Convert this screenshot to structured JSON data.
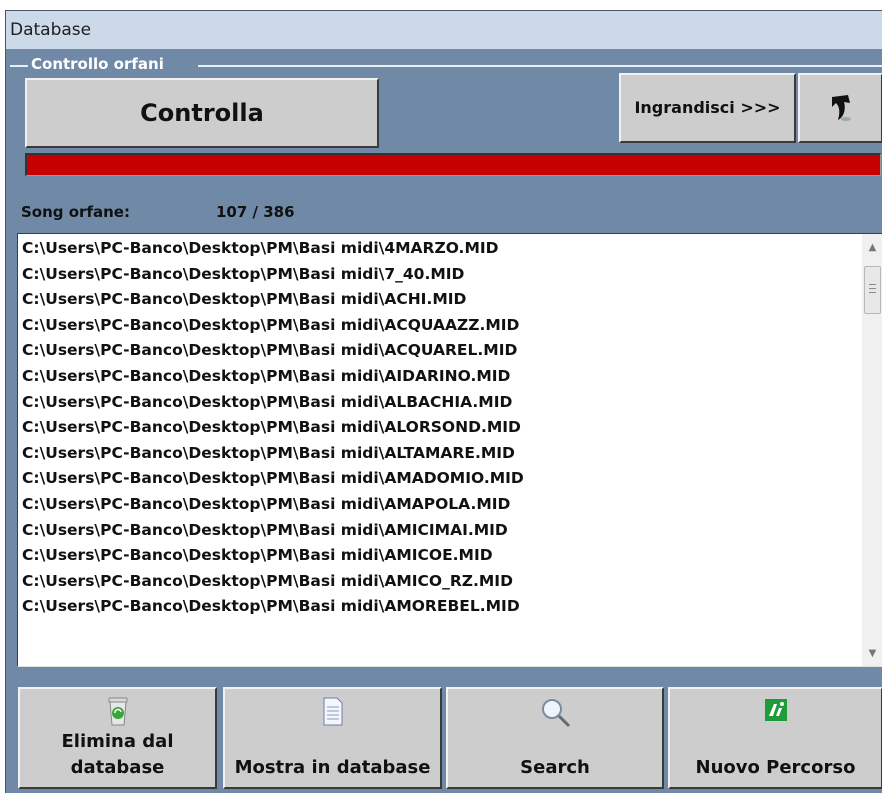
{
  "window": {
    "title": "Database"
  },
  "group": {
    "label": "Controllo orfani"
  },
  "buttons": {
    "controlla": "Controlla",
    "ingrandisci": "Ingrandisci >>>",
    "back_icon": "undo-arrow-icon"
  },
  "progress": {
    "fraction": 1.0,
    "color": "#c60000"
  },
  "orphans": {
    "label": "Song orfane:",
    "value": "107 / 386"
  },
  "list": {
    "items": [
      "C:\\Users\\PC-Banco\\Desktop\\PM\\Basi midi\\4MARZO.MID",
      "C:\\Users\\PC-Banco\\Desktop\\PM\\Basi midi\\7_40.MID",
      "C:\\Users\\PC-Banco\\Desktop\\PM\\Basi midi\\ACHI.MID",
      "C:\\Users\\PC-Banco\\Desktop\\PM\\Basi midi\\ACQUAAZZ.MID",
      "C:\\Users\\PC-Banco\\Desktop\\PM\\Basi midi\\ACQUAREL.MID",
      "C:\\Users\\PC-Banco\\Desktop\\PM\\Basi midi\\AIDARINO.MID",
      "C:\\Users\\PC-Banco\\Desktop\\PM\\Basi midi\\ALBACHIA.MID",
      "C:\\Users\\PC-Banco\\Desktop\\PM\\Basi midi\\ALORSOND.MID",
      "C:\\Users\\PC-Banco\\Desktop\\PM\\Basi midi\\ALTAMARE.MID",
      "C:\\Users\\PC-Banco\\Desktop\\PM\\Basi midi\\AMADOMIO.MID",
      "C:\\Users\\PC-Banco\\Desktop\\PM\\Basi midi\\AMAPOLA.MID",
      "C:\\Users\\PC-Banco\\Desktop\\PM\\Basi midi\\AMICIMAI.MID",
      "C:\\Users\\PC-Banco\\Desktop\\PM\\Basi midi\\AMICOE.MID",
      "C:\\Users\\PC-Banco\\Desktop\\PM\\Basi midi\\AMICO_RZ.MID",
      "C:\\Users\\PC-Banco\\Desktop\\PM\\Basi midi\\AMOREBEL.MID"
    ]
  },
  "bottom_buttons": [
    {
      "label_line1": "Elimina dal",
      "label_line2": "database",
      "icon": "recycle-bin-icon"
    },
    {
      "label": "Mostra in database",
      "icon": "document-icon"
    },
    {
      "label": "Search",
      "icon": "magnifier-icon"
    },
    {
      "label": "Nuovo Percorso",
      "icon": "new-path-icon"
    }
  ]
}
